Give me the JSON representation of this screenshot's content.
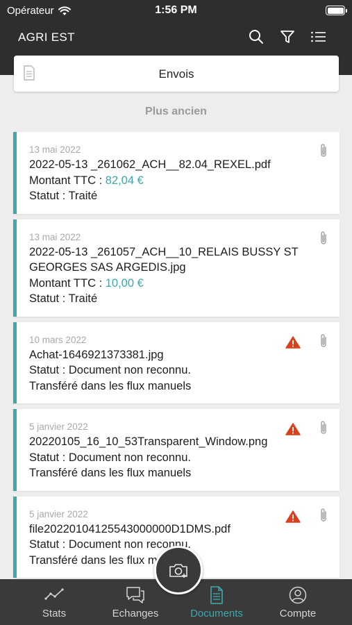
{
  "status_bar": {
    "carrier": "Opérateur",
    "time": "1:56 PM"
  },
  "app_bar": {
    "title": "AGRI EST",
    "actions": [
      "search-icon",
      "filter-icon",
      "list-icon"
    ]
  },
  "subheader": {
    "label": "Envois"
  },
  "section": {
    "label": "Plus ancien"
  },
  "documents": [
    {
      "date": "13 mai 2022",
      "filename": "2022-05-13 _261062_ACH__82.04_REXEL.pdf",
      "amount_label": "Montant TTC : ",
      "amount_value": "82,04 €",
      "status": "Statut : Traité",
      "warning": false
    },
    {
      "date": "13 mai 2022",
      "filename": "2022-05-13 _261057_ACH__10_RELAIS BUSSY ST GEORGES SAS ARGEDIS.jpg",
      "amount_label": "Montant TTC : ",
      "amount_value": "10,00 €",
      "status": "Statut : Traité",
      "warning": false
    },
    {
      "date": "10 mars 2022",
      "filename": "Achat-1646921373381.jpg",
      "status": "Statut : Document non reconnu.",
      "note": "Transféré dans les flux manuels",
      "warning": true
    },
    {
      "date": "5 janvier 2022",
      "filename": "20220105_16_10_53Transparent_Window.png",
      "status": "Statut : Document non reconnu.",
      "note": "Transféré dans les flux manuels",
      "warning": true
    },
    {
      "date": "5 janvier 2022",
      "filename": "file20220104125543000000D1DMS.pdf",
      "status": "Statut : Document non reconnu.",
      "note": "Transféré dans les flux manuels",
      "warning": true
    }
  ],
  "tab_bar": {
    "tabs": [
      {
        "label": "Stats",
        "icon": "stats-icon",
        "active": false
      },
      {
        "label": "Echanges",
        "icon": "chat-icon",
        "active": false
      },
      {
        "label": "Documents",
        "icon": "document-icon",
        "active": true
      },
      {
        "label": "Compte",
        "icon": "account-icon",
        "active": false
      }
    ]
  },
  "colors": {
    "accent": "#3fa8ad",
    "header_bg": "#2e2e2e",
    "tab_bg": "#3a3a3a",
    "warning": "#d9401c"
  }
}
